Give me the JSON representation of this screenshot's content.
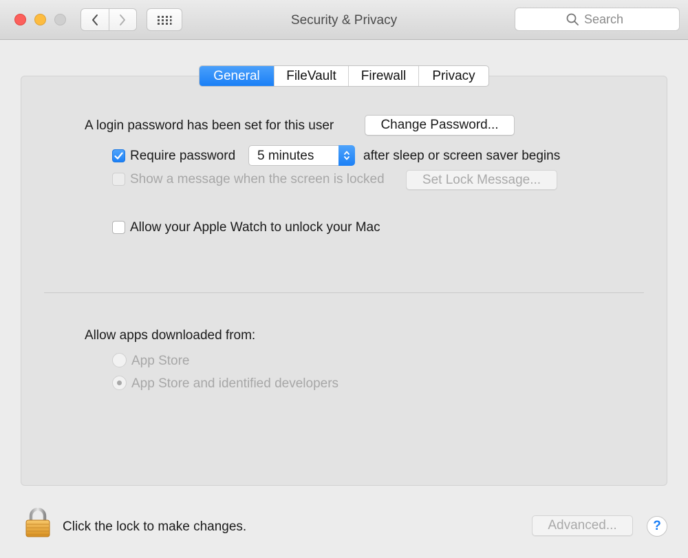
{
  "window": {
    "title": "Security & Privacy"
  },
  "toolbar": {
    "search_placeholder": "Search"
  },
  "tabs": [
    {
      "label": "General",
      "selected": true
    },
    {
      "label": "FileVault",
      "selected": false
    },
    {
      "label": "Firewall",
      "selected": false
    },
    {
      "label": "Privacy",
      "selected": false
    }
  ],
  "general": {
    "login_text": "A login password has been set for this user",
    "change_password_label": "Change Password...",
    "require_password": {
      "label": "Require password",
      "checked": true
    },
    "require_password_delay": "5 minutes",
    "after_sleep_text": "after sleep or screen saver begins",
    "show_message": {
      "label": "Show a message when the screen is locked",
      "checked": false,
      "enabled": false
    },
    "set_lock_message_label": "Set Lock Message...",
    "apple_watch": {
      "label": "Allow your Apple Watch to unlock your Mac",
      "checked": false
    },
    "allow_apps_heading": "Allow apps downloaded from:",
    "app_sources": [
      {
        "label": "App Store",
        "selected": false,
        "enabled": false
      },
      {
        "label": "App Store and identified developers",
        "selected": true,
        "enabled": false
      }
    ]
  },
  "footer": {
    "lock_text": "Click the lock to make changes.",
    "advanced_label": "Advanced...",
    "help_label": "?"
  },
  "colors": {
    "accent": "#1a7ff6",
    "window_bg": "#ececec",
    "panel_bg": "#e3e3e3"
  }
}
